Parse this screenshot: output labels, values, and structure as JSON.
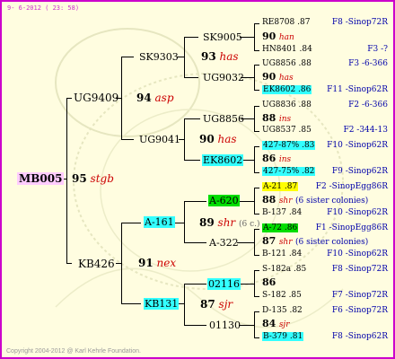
{
  "header": {
    "date": "9- 6-2012 ( 23: 58)"
  },
  "footer": {
    "copyright": "Copyright 2004-2012 @ Karl Kehrle Foundation."
  },
  "gen1": {
    "code": "MB005",
    "num": "95",
    "tag": "stgb"
  },
  "gen2": [
    {
      "code": "UG9409"
    },
    {
      "code": "KB426",
      "num": "91",
      "tag": "nex"
    }
  ],
  "gen3": [
    {
      "code": "SK9303"
    },
    {
      "num": "94",
      "tag": "asp"
    },
    {
      "code": "UG9041"
    },
    {
      "code": "A-161"
    },
    {
      "num": "89",
      "tag": "shr",
      "extra": "(6 c.)"
    },
    {
      "code": "A-322"
    },
    {
      "code": "KB131"
    },
    {
      "num": "87",
      "tag": "sjr"
    }
  ],
  "gen4": [
    {
      "code": "SK9005"
    },
    {
      "num": "93",
      "tag": "has"
    },
    {
      "code": "UG9032"
    },
    {
      "code": "UG8856"
    },
    {
      "num": "90",
      "tag": "has"
    },
    {
      "code": "EK8602"
    },
    {
      "code": "A-620"
    },
    {
      "code": "02116"
    },
    {
      "code": "01130"
    }
  ],
  "gen5": [
    {
      "a": "RE8708 .87",
      "b": "F8 -Sinop72R"
    },
    {
      "num": "90",
      "tag": "han"
    },
    {
      "a": "HN8401 .84",
      "b": "F3 -?"
    },
    {
      "a": "UG8856 .88",
      "b": "F3 -6-366"
    },
    {
      "num": "90",
      "tag": "has"
    },
    {
      "a": "EK8602 .86",
      "b": "F11 -Sinop62R"
    },
    {
      "a": "UG8836 .88",
      "b": "F2 -6-366"
    },
    {
      "num": "88",
      "tag": "ins"
    },
    {
      "a": "UG8537 .85",
      "b": "F2 -344-13"
    },
    {
      "a": "427-87% .83",
      "b": "F10 -Sinop62R"
    },
    {
      "num": "86",
      "tag": "ins"
    },
    {
      "a": "427-75% .82",
      "b": "F9 -Sinop62R"
    },
    {
      "a": "A-21 .87",
      "b": "F2 -SinopEgg86R"
    },
    {
      "num": "88",
      "tag": "shr",
      "extra": "(6 sister colonies)"
    },
    {
      "a": "B-137 .84",
      "b": "F10 -Sinop62R"
    },
    {
      "a": "A-72 .86",
      "b": "F1 -SinopEgg86R"
    },
    {
      "num": "87",
      "tag": "shr",
      "extra": "(6 sister colonies)"
    },
    {
      "a": "B-121 .84",
      "b": "F10 -Sinop62R"
    },
    {
      "a": "S-182a .85",
      "b": "F8 -Sinop72R"
    },
    {
      "num": "86",
      "tag": ""
    },
    {
      "a": "S-182 .85",
      "b": "F7 -Sinop72R"
    },
    {
      "a": "D-135 .82",
      "b": "F6 -Sinop72R"
    },
    {
      "num": "84",
      "tag": "sjr"
    },
    {
      "a": "B-379 .81",
      "b": "F8 -Sinop62R"
    }
  ]
}
